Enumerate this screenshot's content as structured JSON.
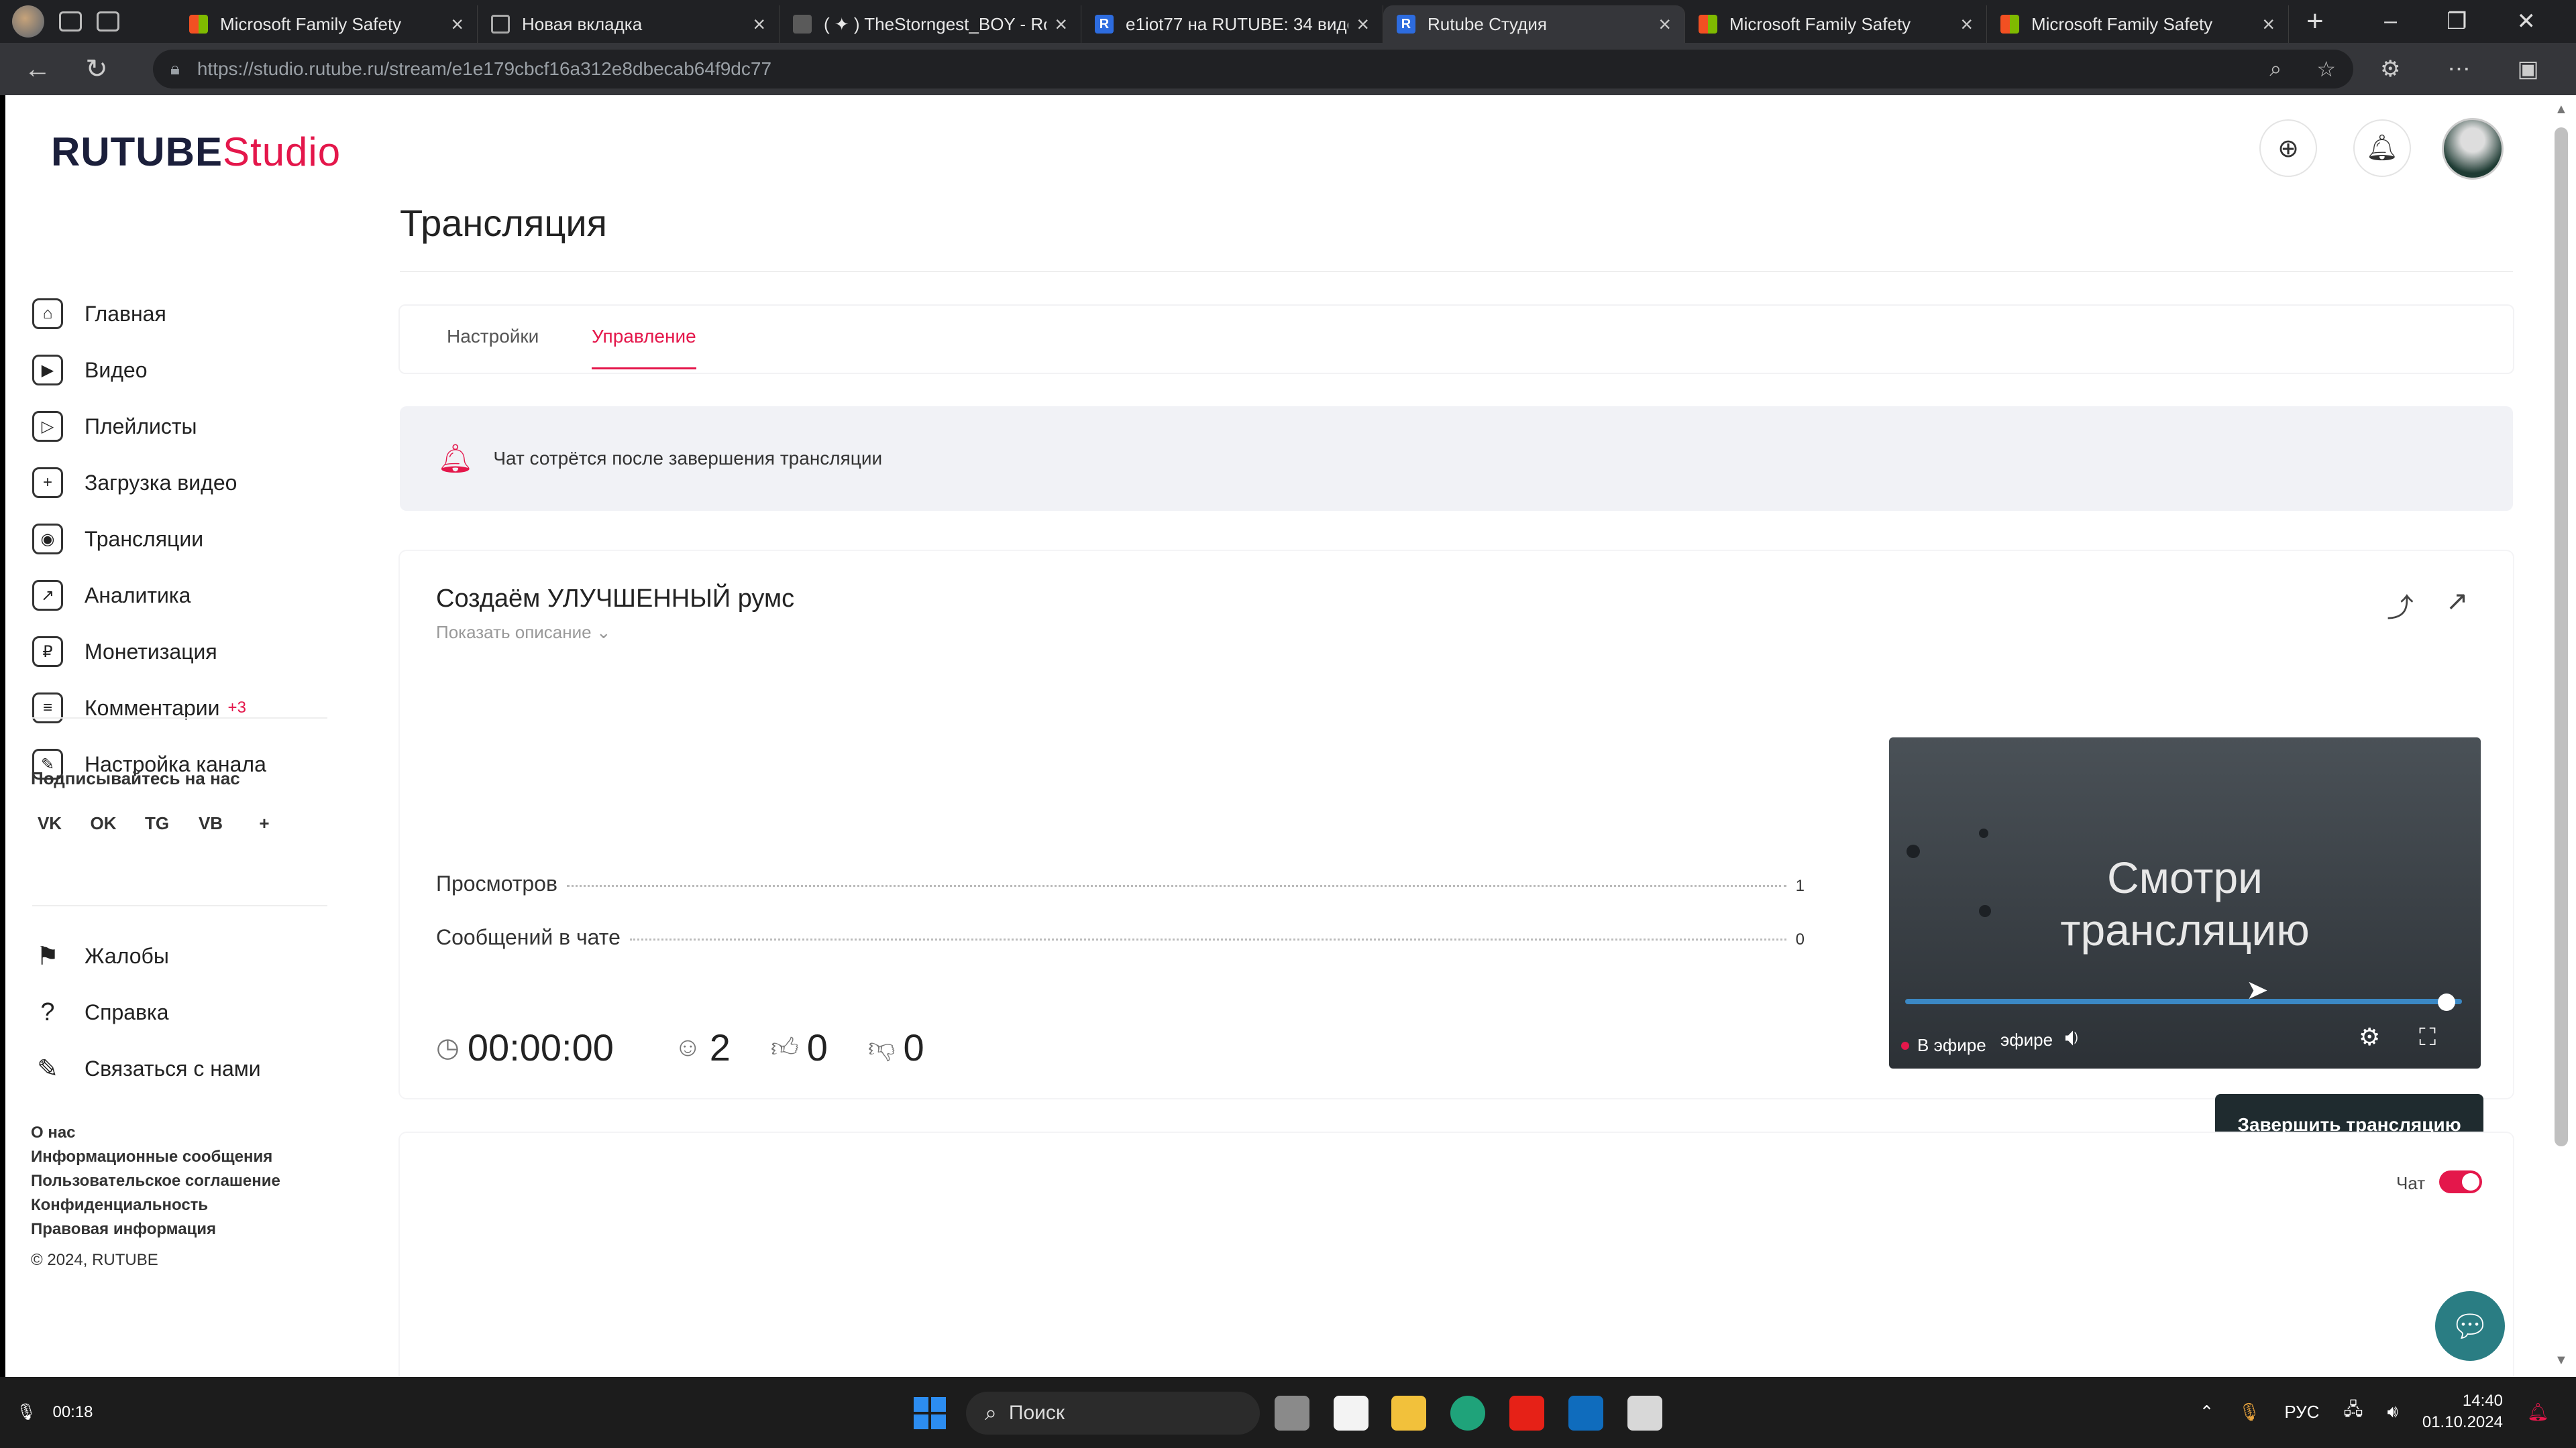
{
  "browser": {
    "tabs": [
      {
        "title": "Microsoft Family Safety",
        "icon": "microsoft-icon"
      },
      {
        "title": "Новая вкладка",
        "icon": "new-tab-icon"
      },
      {
        "title": "( ✦ ) TheStorngest_BOY - Roblo",
        "icon": "roblox-icon"
      },
      {
        "title": "e1iot77 на RUTUBE: 34 видео",
        "icon": "rutube-icon"
      },
      {
        "title": "Rutube Студия",
        "icon": "rutube-icon",
        "active": true
      },
      {
        "title": "Microsoft Family Safety",
        "icon": "microsoft-icon"
      },
      {
        "title": "Microsoft Family Safety",
        "icon": "microsoft-icon"
      }
    ],
    "url": "https://studio.rutube.ru/stream/e1e179cbcf16a312e8dbecab64f9dc77"
  },
  "logo": {
    "brand": "RUTUBE",
    "suffix": "Studio"
  },
  "sidebar": {
    "items": [
      {
        "label": "Главная",
        "icon": "home-icon",
        "glyph": "⌂"
      },
      {
        "label": "Видео",
        "icon": "video-icon",
        "glyph": "▶"
      },
      {
        "label": "Плейлисты",
        "icon": "playlist-icon",
        "glyph": "▷"
      },
      {
        "label": "Загрузка видео",
        "icon": "upload-icon",
        "glyph": "+"
      },
      {
        "label": "Трансляции",
        "icon": "broadcast-icon",
        "glyph": "◉"
      },
      {
        "label": "Аналитика",
        "icon": "analytics-icon",
        "glyph": "↗"
      },
      {
        "label": "Монетизация",
        "icon": "monetization-icon",
        "glyph": "₽"
      },
      {
        "label": "Комментарии",
        "icon": "comments-icon",
        "glyph": "≡",
        "badge": "+3"
      },
      {
        "label": "Настройка канала",
        "icon": "channel-settings-icon",
        "glyph": "✎"
      }
    ],
    "follow_label": "Подписывайтесь на нас",
    "socials": [
      "VK",
      "OK",
      "TG",
      "VB",
      "+"
    ],
    "secondary": [
      {
        "label": "Жалобы",
        "icon": "flag-icon",
        "glyph": "⚑"
      },
      {
        "label": "Справка",
        "icon": "help-icon",
        "glyph": "?"
      },
      {
        "label": "Связаться с нами",
        "icon": "contact-icon",
        "glyph": "✎"
      }
    ],
    "links": [
      "О нас",
      "Информационные сообщения",
      "Пользовательское соглашение",
      "Конфиденциальность",
      "Правовая информация"
    ],
    "copyright": "© 2024, RUTUBE"
  },
  "main": {
    "title": "Трансляция",
    "tabs": [
      "Настройки",
      "Управление"
    ],
    "active_tab": "Управление",
    "notice": "Чат сотрётся после завершения трансляции",
    "stream": {
      "title": "Создаём УЛУЧШЕННЫЙ румс",
      "show_description": "Показать описание",
      "stats": [
        {
          "label": "Просмотров",
          "value": "1"
        },
        {
          "label": "Сообщений в чате",
          "value": "0"
        }
      ],
      "duration": "00:00:00",
      "viewers": "2",
      "likes": "0",
      "dislikes": "0",
      "player": {
        "line1": "Смотри",
        "line2": "трансляцию",
        "live_label": "В эфире",
        "onair_overlay": "эфире",
        "progress": 1.0
      },
      "end_button": "Завершить трансляцию"
    },
    "chat": {
      "label": "Чат",
      "enabled": true
    }
  },
  "taskbar": {
    "recording_time": "00:18",
    "search_placeholder": "Поиск",
    "lang": "РУС",
    "time": "14:40",
    "date": "01.10.2024"
  },
  "colors": {
    "accent": "#e4174b",
    "button_dark": "#1f2b2f",
    "progress": "#3b88c4"
  }
}
